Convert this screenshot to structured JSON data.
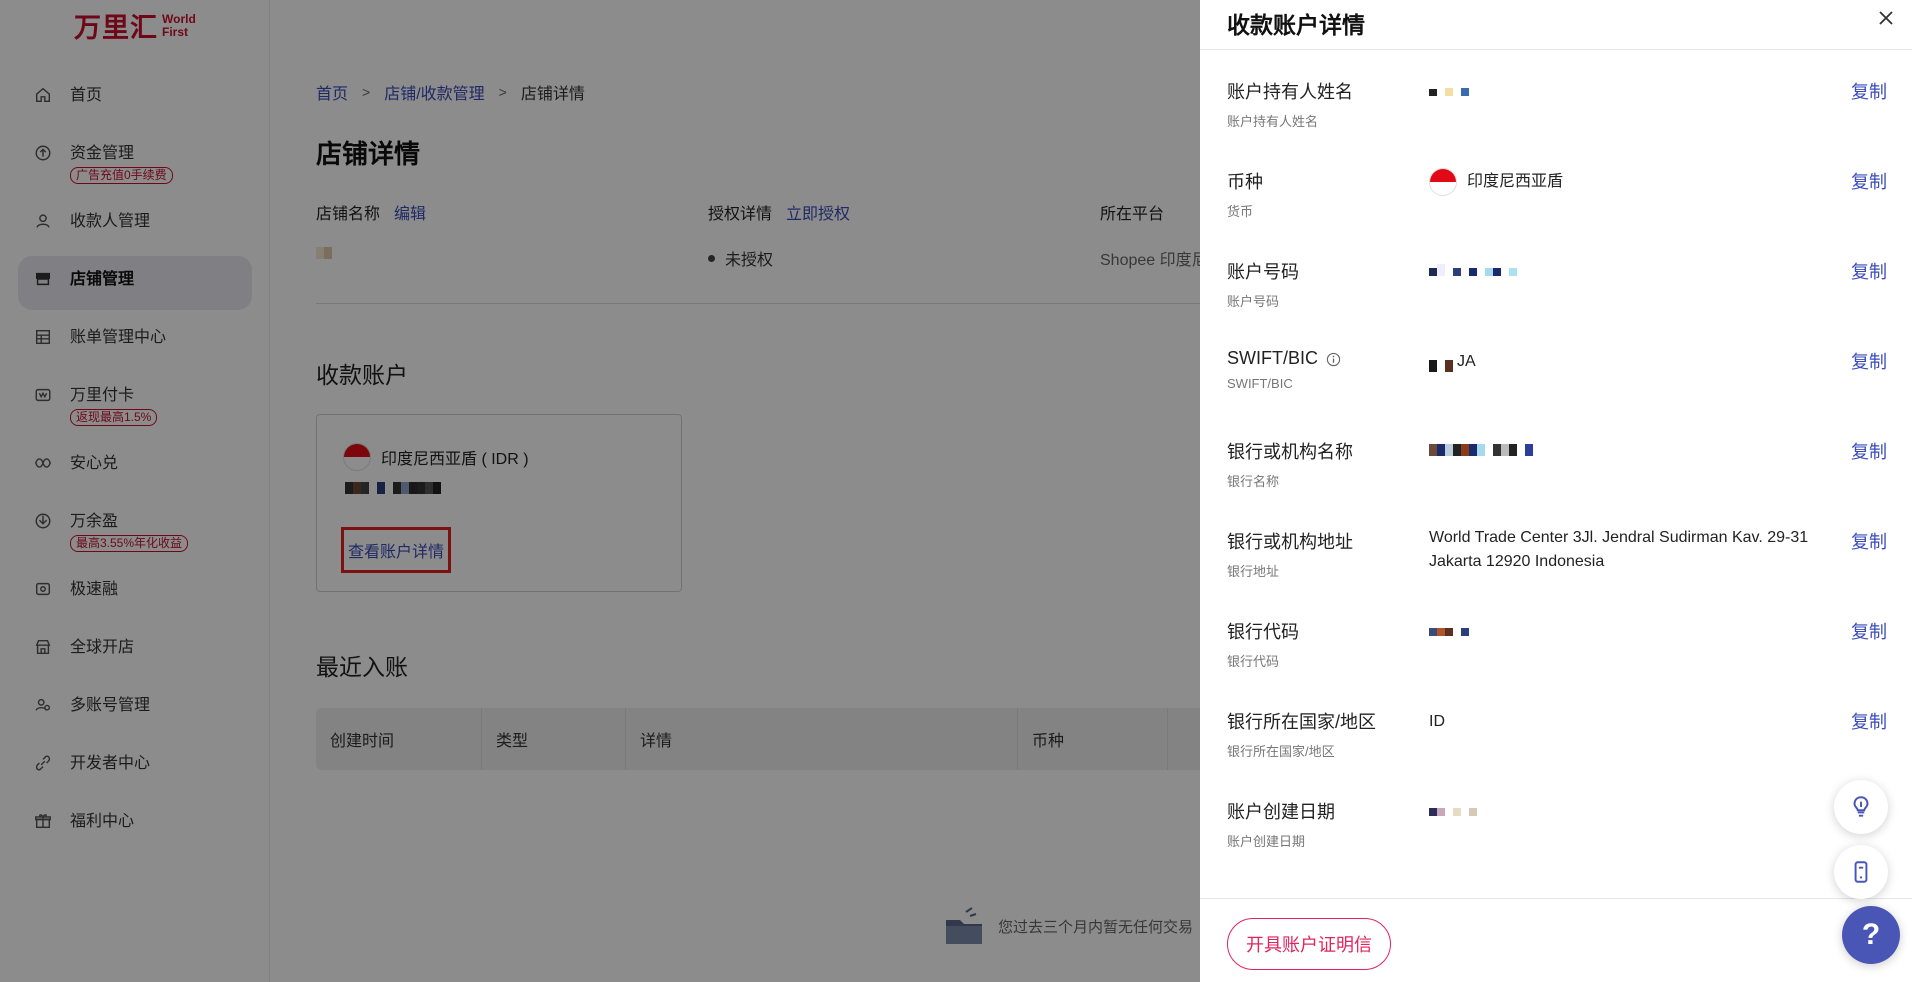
{
  "logo": {
    "cn": "万里汇",
    "en_line1": "World",
    "en_line2": "First"
  },
  "sidebar": {
    "items": [
      {
        "label": "首页",
        "icon": "home-icon"
      },
      {
        "label": "资金管理",
        "badge": "广告充值0手续费",
        "icon": "fund-icon"
      },
      {
        "label": "收款人管理",
        "icon": "user-icon"
      },
      {
        "label": "店铺管理",
        "icon": "store-icon",
        "active": true
      },
      {
        "label": "账单管理中心",
        "icon": "bill-icon"
      },
      {
        "label": "万里付卡",
        "badge": "返现最高1.5%",
        "icon": "card-icon"
      },
      {
        "label": "安心兑",
        "icon": "exchange-icon"
      },
      {
        "label": "万余盈",
        "badge": "最高3.55%年化收益",
        "icon": "yield-icon"
      },
      {
        "label": "极速融",
        "icon": "finance-icon"
      },
      {
        "label": "全球开店",
        "icon": "shop-global-icon"
      },
      {
        "label": "多账号管理",
        "icon": "multi-account-icon"
      },
      {
        "label": "开发者中心",
        "icon": "developer-icon"
      },
      {
        "label": "福利中心",
        "icon": "gift-icon"
      }
    ]
  },
  "main": {
    "breadcrumb": [
      "首页",
      "店铺/收款管理",
      "店铺详情"
    ],
    "title": "店铺详情",
    "store_name_label": "店铺名称",
    "edit_label": "编辑",
    "auth_label": "授权详情",
    "auth_link": "立即授权",
    "auth_status": "未授权",
    "platform_label": "所在平台",
    "platform_value": "Shopee 印度尼",
    "accounts_title": "收款账户",
    "account_currency": "印度尼西亚盾 ( IDR )",
    "view_detail": "查看账户详情",
    "recent_title": "最近入账",
    "table_headers": [
      "创建时间",
      "类型",
      "详情",
      "币种"
    ],
    "empty_text": "您过去三个月内暂无任何交易"
  },
  "drawer": {
    "title": "收款账户详情",
    "copy_label": "复制",
    "fields": [
      {
        "label": "账户持有人姓名",
        "sub": "账户持有人姓名",
        "value": ""
      },
      {
        "label": "币种",
        "sub": "货币",
        "value": "印度尼西亚盾"
      },
      {
        "label": "账户号码",
        "sub": "账户号码",
        "value": ""
      },
      {
        "label": "SWIFT/BIC",
        "sub": "SWIFT/BIC",
        "value": "JA"
      },
      {
        "label": "银行或机构名称",
        "sub": "银行名称",
        "value": ""
      },
      {
        "label": "银行或机构地址",
        "sub": "银行地址",
        "value": "World Trade Center 3Jl. Jendral Sudirman Kav. 29-31 Jakarta 12920 Indonesia"
      },
      {
        "label": "银行代码",
        "sub": "银行代码",
        "value": ""
      },
      {
        "label": "银行所在国家/地区",
        "sub": "银行所在国家/地区",
        "value": "ID"
      },
      {
        "label": "账户创建日期",
        "sub": "账户创建日期",
        "value": ""
      }
    ],
    "footer_button": "开具账户证明信",
    "help_label": "?"
  },
  "colors": {
    "brand": "#c8102e",
    "link": "#3b4cb8",
    "pink": "#e0245e",
    "highlight_box": "#e02020"
  }
}
